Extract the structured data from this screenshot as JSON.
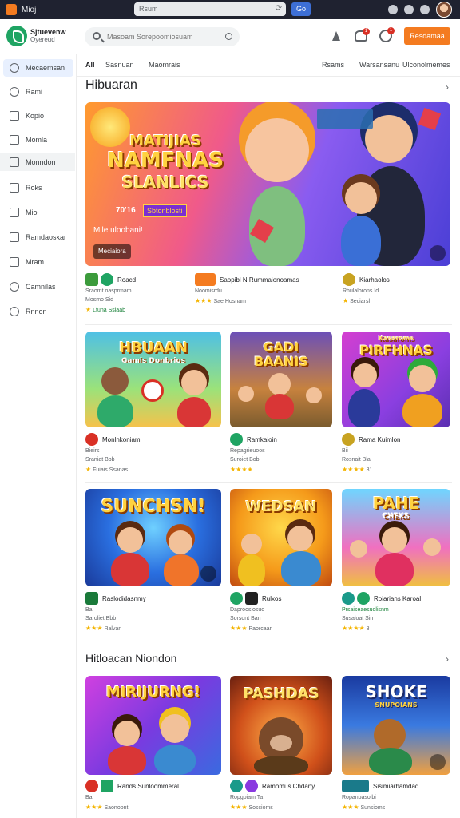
{
  "browser": {
    "title": "Mioj",
    "url_text": "Rsum",
    "go_label": "Go"
  },
  "header": {
    "brand_line1": "Sjtuevenw",
    "brand_line2": "Oyereud",
    "search_placeholder": "Masoam Sorepoomiosuam",
    "cta_label": "Resdamaa",
    "notif_count_1": "1",
    "notif_count_2": "1"
  },
  "sidebar": {
    "items": [
      {
        "label": "Mecaemsan",
        "icon": "search-icon"
      },
      {
        "label": "Rami",
        "icon": "home-icon"
      },
      {
        "label": "Kopio",
        "icon": "tag-icon"
      },
      {
        "label": "Momla",
        "icon": "document-icon"
      },
      {
        "label": "Monndon",
        "icon": "grid-icon"
      },
      {
        "label": "Roks",
        "icon": "calendar-icon"
      },
      {
        "label": "Mio",
        "icon": "checkbox-icon"
      },
      {
        "label": "Ramdaoskar",
        "icon": "list-icon"
      },
      {
        "label": "Mram",
        "icon": "book-icon"
      },
      {
        "label": "Camnilas",
        "icon": "chat-icon"
      },
      {
        "label": "Rnnon",
        "icon": "clock-icon"
      }
    ]
  },
  "tabs": [
    "All",
    "Sasnuan",
    "Maomrais",
    "Rsams",
    "Warsansanu",
    "Ulconolmemes"
  ],
  "section1": {
    "title": "Hibuaran",
    "hero": {
      "art_title_line1": "MATIJIAS",
      "art_title_line2": "NAMFNAS",
      "art_title_line3": "SLANLICS",
      "tag_left": "70'16",
      "tag_right": "Sbtonblosti",
      "subtitle": "Mile uloobani!",
      "button_label": "Meciaiora"
    },
    "hero_meta": [
      {
        "name": "Roacd",
        "sub": "Sraomt oasprmam",
        "rate": "Mosmo Sid",
        "dl": "Lfuna Ssiaab"
      },
      {
        "name": "Saopibl N Rummaionoamas",
        "sub": "Noomisrdu",
        "rate": "Sae Hosnam",
        "dl": ""
      },
      {
        "name": "Kiarhaolos",
        "sub": "Rhulalorons Id",
        "rate": "Seciarsl",
        "dl": ""
      }
    ]
  },
  "grid1": [
    {
      "art": "HBUAAN",
      "art2": "Gamis Donbrios",
      "name": "Monlnkoniam",
      "sub": "Bieirs",
      "rate": "Sraniat Bbb",
      "dl": "Fuiais Ssanas"
    },
    {
      "art": "GADI",
      "art2": "BAANIS",
      "name": "Ramkaioin",
      "sub": "Repagrieuoos",
      "rate": "Suroiet Bob",
      "dl": ""
    },
    {
      "art": "PIRFHNAS",
      "art2": "Kasaroms",
      "name": "Rama Kuimlon",
      "sub": "Bii",
      "rate": "Rosnait Bla",
      "dl": "81"
    }
  ],
  "grid2": [
    {
      "art": "SUNCHSN!",
      "name": "Raslodidasnmy",
      "sub": "Ba",
      "rate": "Saroliet Bbb",
      "dl": "Ralvan"
    },
    {
      "art": "WEDSAN",
      "name": "Rulxos",
      "sub": "Daprooslosuo",
      "rate": "Sorsont Ban",
      "dl": "Paorcaan"
    },
    {
      "art": "PAHE",
      "art2": "CHEKS",
      "name": "Roiarians Karoal",
      "sub": "Prsaiseaesuolisnm",
      "rate": "Susaloat Sin",
      "dl": "8"
    }
  ],
  "section2": {
    "title": "Hitloacan Niondon"
  },
  "grid3": [
    {
      "art": "MIRIJURNG!",
      "name": "Rands Sunloommeral",
      "sub": "Ba",
      "rate": "Saonoont",
      "dl": ""
    },
    {
      "art": "PASHDAS",
      "name": "Ramomus Chdany",
      "sub": "Ropgoiam Ta",
      "rate": "Soscioms",
      "dl": ""
    },
    {
      "art": "SHOKE",
      "art2": "SNUPOIANS",
      "name": "Sisimiarhamdad",
      "sub": "Ropanoasolbi",
      "rate": "Sunsioms",
      "dl": ""
    }
  ],
  "colors": {
    "accent": "#f47b20",
    "brand": "#1fa463",
    "star": "#f4b400",
    "active_bg": "#e8f0fe"
  }
}
